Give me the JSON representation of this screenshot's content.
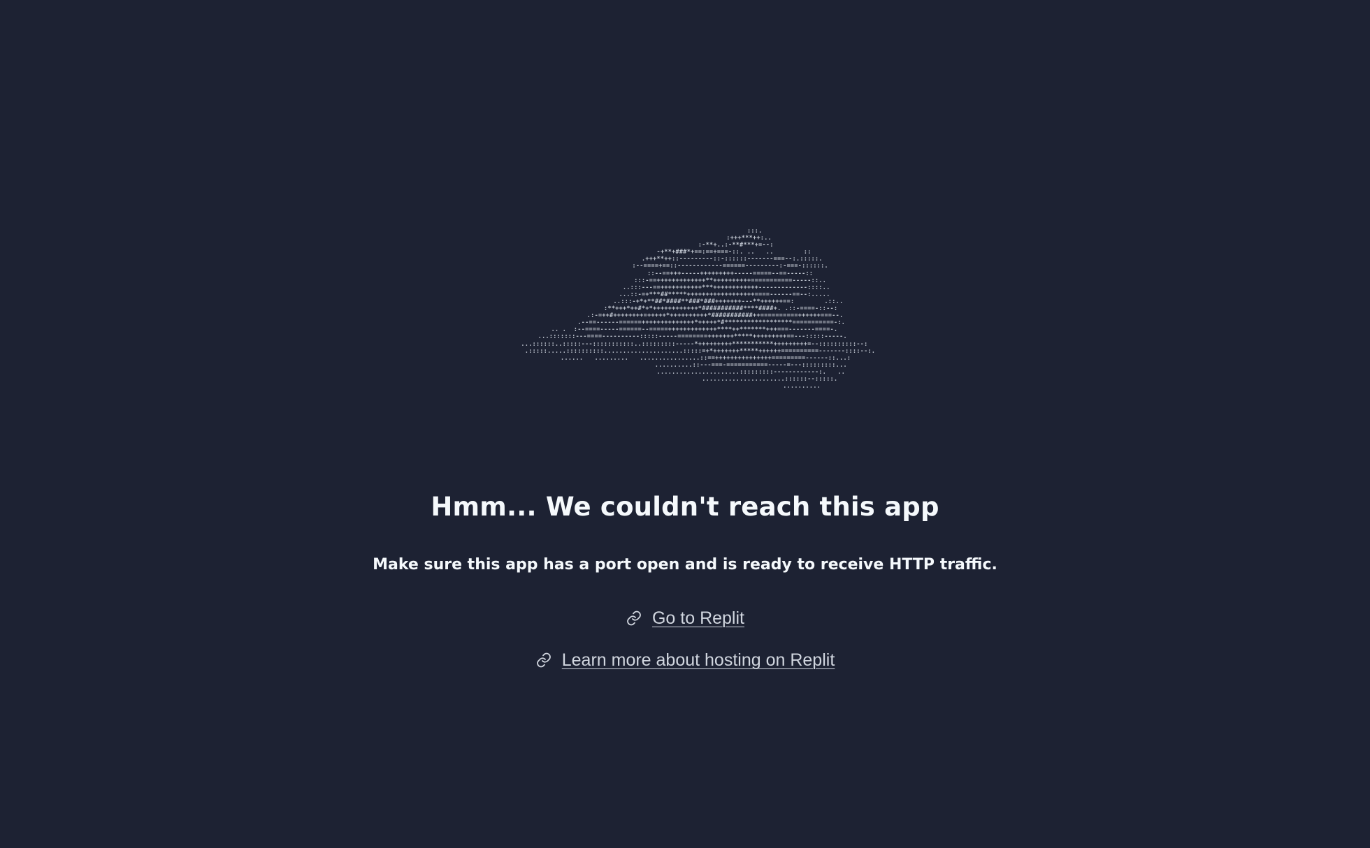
{
  "ascii_art": {
    "text": "                                     :::.\n                                  :+++***++:..\n                           :-**+..:-**#***+=--:\n                          -+**+###*+==:==+===-::. ..   ..        ::\n                         .+++**++::---------::-::::::-------===--:.:::::.\n                        :--====+==::------------======---------:-===-::::::.\n                        ::--==+++-----+++++++++-----=====--==-----::\n                        :::-==+++++++++++++**++++++++++===========-----::..\n                      ..:::---==+++++++++++***++++++++++++-------------::::..\n                     ...::-=+***##*****++++++++++++++++++====------==--:.....\n                       ..:::-+*+**##*####**###*###+++++++---**++++++==:        .::..\n                   :**+++*++#*+*++++++++++++*###########****####+. .::-====-::--:\n                .:-=++#++++++++=+++++*++++++++++*###########++==========++++++===--.\n              .--==------======++++++++++++++*+++++*#******************===========-:.\n     .. .  :--====-----======--=====+++++++++++++****++*******+++===-------====-.\n    ...:::::::---====----------:::::-----========+++++++*****+++++++++==---:::::-----.\n     ...::::::..:::::---:::::::::::..:::::::::-----*+++++++++***********+++++++++=--::::::::::--:\n        .:::::.....::::::::::.....................:::::=+*+++++++*****++++++==========-------::::--:.\n           ......   .........   ................::==+++++++++++++++=========------::...:\n                                   ..........::---===-===========-----=---:::::::::...\n                                   ......................:::::::::------------:.   ..\n                                             ......................::::::--:::::.\n                                                              ..........",
    "description_hidden": ""
  },
  "title": "Hmm... We couldn't reach this app",
  "subtitle": "Make sure this app has a port open and is ready to receive HTTP traffic.",
  "links": [
    {
      "label": "Go to Replit",
      "icon": "link-icon"
    },
    {
      "label": "Learn more about hosting on Replit",
      "icon": "link-icon"
    }
  ],
  "colors": {
    "background": "#1d2233",
    "text_primary": "#f5f9fc",
    "link": "#d1d6df",
    "ascii": "#c2c8d2"
  }
}
